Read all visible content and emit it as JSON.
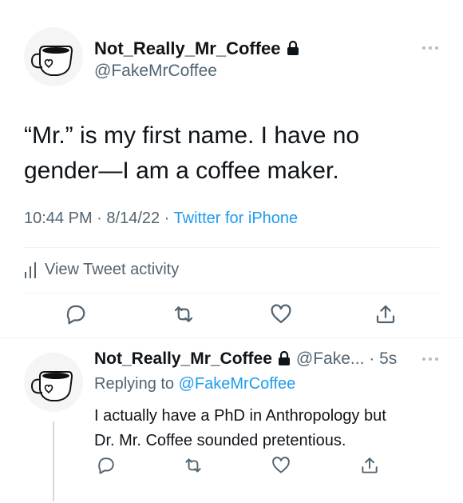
{
  "main_tweet": {
    "display_name": "Not_Really_Mr_Coffee",
    "handle": "@FakeMrCoffee",
    "text_line1": "“Mr.” is my first name. I have no",
    "text_line2": "gender—I am a coffee maker.",
    "time": "10:44 PM",
    "sep1": " · ",
    "date": "8/14/22",
    "sep2": " · ",
    "source": "Twitter for iPhone",
    "activity_label": "View Tweet activity"
  },
  "reply_tweet": {
    "display_name": "Not_Really_Mr_Coffee",
    "handle": "@Fake...",
    "sep": " · ",
    "time": "5s",
    "replying_prefix": "Replying to ",
    "replying_to": "@FakeMrCoffee",
    "text_line1": "I actually have a PhD in Anthropology but",
    "text_line2": "Dr. Mr. Coffee sounded pretentious."
  },
  "icons": {
    "avatar": "coffee-mug-heart-icon",
    "protected": "lock-icon",
    "more": "more-dots-icon",
    "activity": "bar-chart-icon",
    "reply": "reply-icon",
    "retweet": "retweet-icon",
    "like": "heart-icon",
    "share": "share-icon"
  },
  "colors": {
    "text": "#0f1419",
    "secondary": "#536471",
    "link": "#1d9bf0",
    "divider": "#eff3f4"
  }
}
